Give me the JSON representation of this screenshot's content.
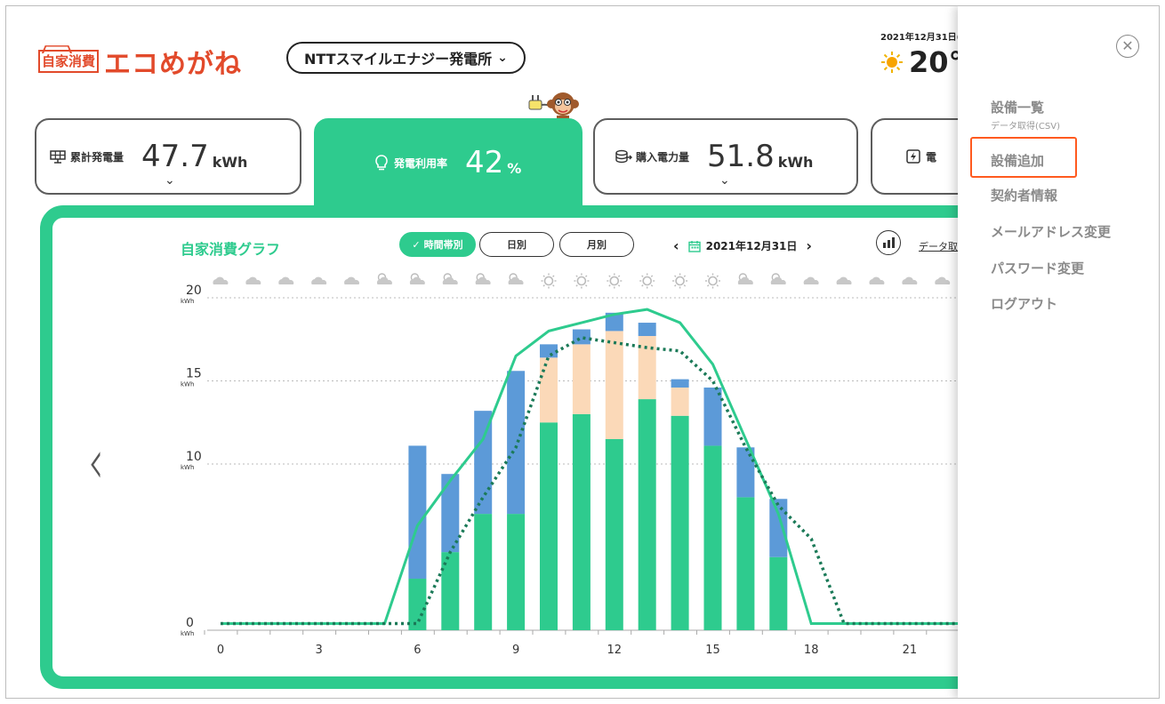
{
  "header": {
    "logo_badge": "自家消費",
    "logo_text": "エコめがね",
    "plant_name": "NTTスマイルエナジー発電所",
    "date": "2021年12月31日(",
    "temperature": "20°"
  },
  "cards": [
    {
      "label": "累計発電量",
      "value": "47.7",
      "unit": "kWh",
      "icon": "solar-panel-icon"
    },
    {
      "label": "発電利用率",
      "value": "42",
      "unit": "%",
      "icon": "lightbulb-icon"
    },
    {
      "label": "購入電力量",
      "value": "51.8",
      "unit": "kWh",
      "icon": "coins-icon"
    },
    {
      "label": "電",
      "icon": "battery-bolt-icon"
    }
  ],
  "panel": {
    "title": "自家消費グラフ",
    "tabs": [
      {
        "label": "時間帯別",
        "selected": true
      },
      {
        "label": "日別",
        "selected": false
      },
      {
        "label": "月別",
        "selected": false
      }
    ],
    "date": "2021年12月31日",
    "data_link": "データ取得"
  },
  "colors": {
    "green": "#2ecb8e",
    "blue": "#5c9ad8",
    "peach": "#fbd9b8",
    "dark_green": "#1b7a58",
    "menu_highlight": "#ff5a1f"
  },
  "chart_data": {
    "type": "bar",
    "x": [
      0,
      1,
      2,
      3,
      4,
      5,
      6,
      7,
      8,
      9,
      10,
      11,
      12,
      13,
      14,
      15,
      16,
      17,
      18,
      19,
      20,
      21,
      22,
      23
    ],
    "x_ticks": [
      "0",
      "3",
      "6",
      "9",
      "12",
      "15",
      "18",
      "21"
    ],
    "y_ticks": [
      "0",
      "10",
      "15",
      "20"
    ],
    "y_unit": "kWh",
    "ylim": [
      0,
      20
    ],
    "grid": true,
    "weather": [
      "cloud",
      "cloud",
      "cloud",
      "cloud",
      "cloud",
      "sun-cloud",
      "sun-cloud",
      "sun-cloud",
      "sun-cloud",
      "sun-cloud",
      "sun",
      "sun",
      "sun",
      "sun",
      "sun",
      "sun",
      "sun-cloud",
      "sun-cloud",
      "cloud",
      "cloud",
      "cloud",
      "cloud",
      "cloud",
      "cloud"
    ],
    "series": [
      {
        "values": [
          0,
          0,
          0,
          0,
          0,
          0,
          3.1,
          4.7,
          7.0,
          7.0,
          12.5,
          13.0,
          11.5,
          13.9,
          12.9,
          11.1,
          8.0,
          4.4,
          0,
          0,
          0,
          0,
          0,
          0
        ]
      },
      {
        "values": [
          0,
          0,
          0,
          0,
          0,
          0,
          0,
          0,
          0,
          0,
          3.9,
          4.2,
          6.5,
          3.8,
          1.7,
          0,
          0,
          0,
          0,
          0,
          0,
          0,
          0,
          0
        ]
      },
      {
        "values": [
          0,
          0,
          0,
          0,
          0,
          0,
          8.0,
          4.7,
          6.2,
          8.6,
          0.8,
          0.9,
          1.1,
          0.8,
          0.5,
          3.5,
          3.0,
          3.5,
          0,
          0,
          0,
          0,
          0,
          0
        ]
      },
      {
        "values": [
          0.4,
          0.4,
          0.4,
          0.4,
          0.4,
          0.4,
          6.3,
          9.0,
          11.5,
          16.5,
          18.0,
          18.5,
          19.0,
          19.3,
          18.5,
          16.0,
          11.5,
          7.0,
          0.4,
          0.4,
          0.4,
          0.4,
          0.4,
          0.4
        ]
      },
      {
        "values": [
          0.4,
          0.4,
          0.4,
          0.4,
          0.4,
          0.4,
          0.4,
          4.7,
          8.0,
          11.0,
          16.5,
          17.6,
          17.3,
          17.0,
          16.8,
          15.0,
          11.0,
          7.5,
          5.5,
          0.4,
          0.4,
          0.4,
          0.4,
          0.4
        ]
      }
    ]
  },
  "menu": {
    "items": [
      {
        "label": "設備一覧",
        "sub": "データ取得(CSV)"
      },
      {
        "label": "設備追加"
      },
      {
        "label": "契約者情報"
      },
      {
        "label": "メールアドレス変更"
      },
      {
        "label": "パスワード変更"
      },
      {
        "label": "ログアウト"
      }
    ]
  }
}
